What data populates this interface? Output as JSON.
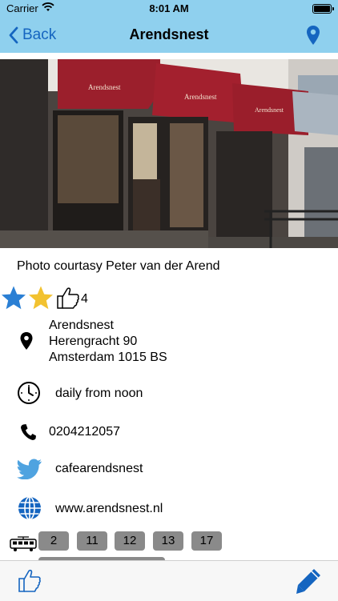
{
  "status_bar": {
    "carrier": "Carrier",
    "time": "8:01 AM"
  },
  "nav": {
    "back_label": "Back",
    "title": "Arendsnest"
  },
  "caption": "Photo courtasy Peter van der Arend",
  "rating": {
    "filled_stars": 2,
    "star_colors": [
      "#2a7fd4",
      "#f2c230"
    ],
    "likes": "4"
  },
  "address": {
    "name": "Arendsnest",
    "street": "Herengracht 90",
    "city": "Amsterdam 1015 BS"
  },
  "hours": "daily from noon",
  "phone": "0204212057",
  "twitter": "cafearendsnest",
  "website": "www.arendsnest.nl",
  "tram_lines": [
    "2",
    "11",
    "12",
    "13",
    "17"
  ],
  "colors": {
    "nav_background": "#8fd0ee",
    "accent": "#1565c0",
    "twitter_blue": "#4fa3e0",
    "badge": "#8a8a8a"
  }
}
